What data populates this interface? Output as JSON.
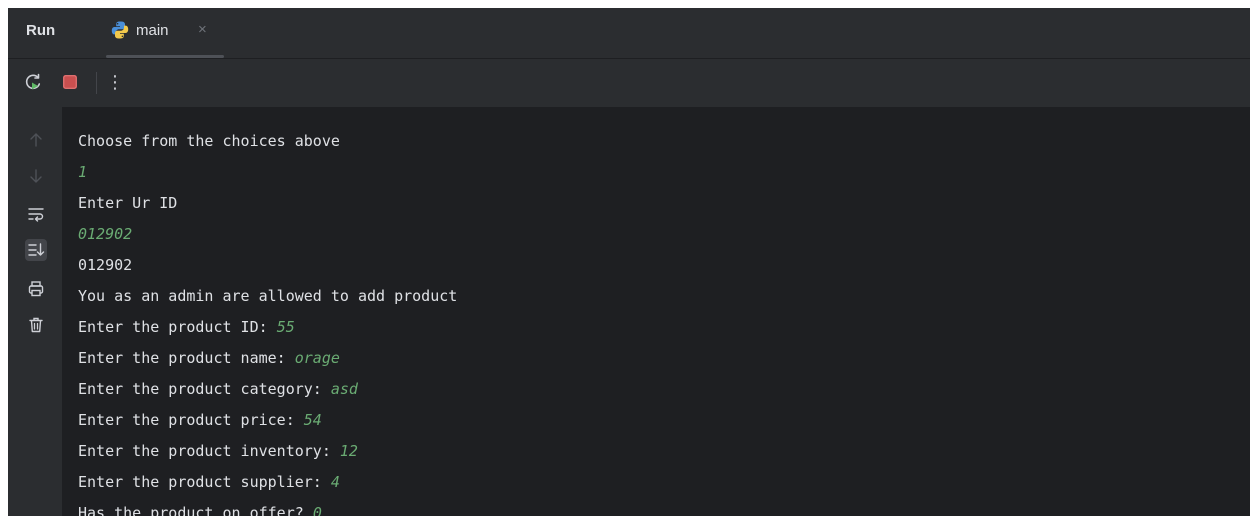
{
  "header": {
    "run_label": "Run",
    "tab": {
      "label": "main",
      "icon": "python-icon",
      "close": "×"
    }
  },
  "toolbar": {
    "rerun_icon": "rerun-icon",
    "stop_icon": "stop-icon",
    "more_label": "⋮"
  },
  "gutter": {
    "icons": [
      "arrow-up-icon",
      "arrow-down-icon",
      "soft-wrap-icon",
      "scroll-to-end-icon",
      "print-icon",
      "trash-icon"
    ]
  },
  "console": {
    "lines": [
      {
        "text": "Choose from the choices above",
        "input": ""
      },
      {
        "text": "",
        "input": "1"
      },
      {
        "text": "Enter Ur ID",
        "input": ""
      },
      {
        "text": "",
        "input": "012902"
      },
      {
        "text": "012902",
        "input": ""
      },
      {
        "text": "You as an admin are allowed to add product",
        "input": ""
      },
      {
        "text": "Enter the product ID: ",
        "input": "55"
      },
      {
        "text": "Enter the product name: ",
        "input": "orage"
      },
      {
        "text": "Enter the product category: ",
        "input": "asd"
      },
      {
        "text": "Enter the product price: ",
        "input": "54"
      },
      {
        "text": "Enter the product inventory: ",
        "input": "12"
      },
      {
        "text": "Enter the product supplier: ",
        "input": "4"
      },
      {
        "text": "Has the product on offer? ",
        "input": "0"
      }
    ]
  },
  "colors": {
    "background": "#1e1f22",
    "panel": "#2b2d30",
    "text": "#dfe1e5",
    "user_input": "#6aab73",
    "stop_red": "#c94f4f",
    "rerun_green": "#5fb865"
  }
}
